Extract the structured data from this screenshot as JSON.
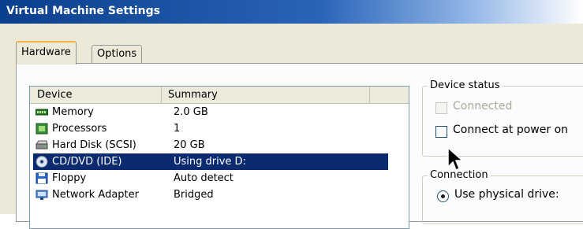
{
  "window": {
    "title": "Virtual Machine Settings"
  },
  "tabs": [
    {
      "label": "Hardware",
      "active": true
    },
    {
      "label": "Options",
      "active": false
    }
  ],
  "device_list": {
    "headers": {
      "device": "Device",
      "summary": "Summary"
    },
    "rows": [
      {
        "device": "Memory",
        "summary": "2.0 GB",
        "icon": "memory-icon",
        "selected": false
      },
      {
        "device": "Processors",
        "summary": "1",
        "icon": "processor-icon",
        "selected": false
      },
      {
        "device": "Hard Disk (SCSI)",
        "summary": "20 GB",
        "icon": "hard-disk-icon",
        "selected": false
      },
      {
        "device": "CD/DVD (IDE)",
        "summary": "Using drive D:",
        "icon": "cd-dvd-icon",
        "selected": true
      },
      {
        "device": "Floppy",
        "summary": "Auto detect",
        "icon": "floppy-icon",
        "selected": false
      },
      {
        "device": "Network Adapter",
        "summary": "Bridged",
        "icon": "network-adapter-icon",
        "selected": false
      }
    ]
  },
  "device_status": {
    "label": "Device status",
    "connected": {
      "label": "Connected",
      "checked": false,
      "enabled": false
    },
    "connect_at_power_on": {
      "label": "Connect at power on",
      "checked": false,
      "enabled": true
    }
  },
  "connection": {
    "label": "Connection",
    "use_physical_drive": {
      "label": "Use physical drive:",
      "selected": true
    }
  },
  "colors": {
    "title_bar": "#0a3f8c",
    "selection": "#0b2a6f",
    "tab_highlight": "#f0b43c",
    "dialog_face": "#ece9d8"
  }
}
